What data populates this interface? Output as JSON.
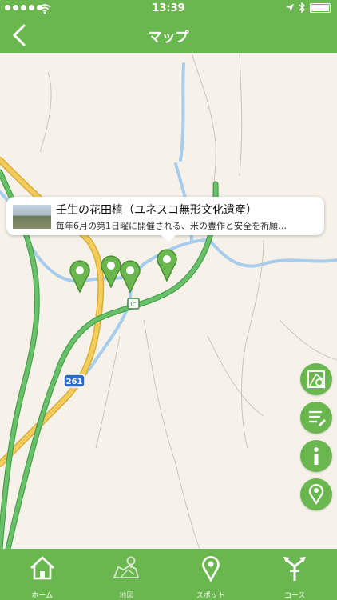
{
  "status": {
    "time": "13:39"
  },
  "nav": {
    "title": "マップ"
  },
  "map": {
    "road_shield": "261",
    "ic_label": "IC",
    "callout": {
      "title": "壬生の花田植（ユネスコ無形文化遺産）",
      "description": "毎年6月の第1日曜に開催される、米の豊作と安全を祈願…"
    }
  },
  "tabs": [
    {
      "label": "ホーム",
      "icon": "home-icon"
    },
    {
      "label": "地図",
      "icon": "map-icon"
    },
    {
      "label": "スポット",
      "icon": "spot-pin-icon"
    },
    {
      "label": "コース",
      "icon": "course-arrows-icon"
    }
  ],
  "colors": {
    "accent": "#6bb74f",
    "road_major": "#f3cd5c",
    "road_highway": "#69c26a",
    "river": "#a8cdec"
  }
}
